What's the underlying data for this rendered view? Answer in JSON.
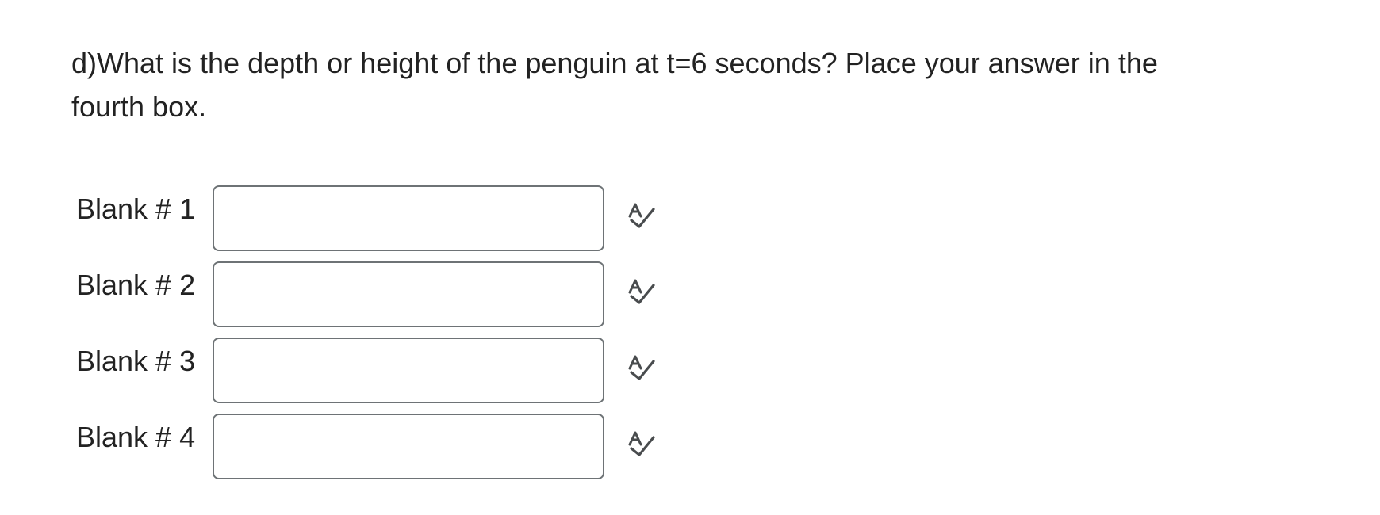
{
  "question": {
    "text": "d)What is the depth or height of the penguin at t=6 seconds? Place your answer in the fourth box."
  },
  "blanks": [
    {
      "label": "Blank # 1",
      "value": "",
      "icon": "spell-check-icon"
    },
    {
      "label": "Blank # 2",
      "value": "",
      "icon": "spell-check-icon"
    },
    {
      "label": "Blank # 3",
      "value": "",
      "icon": "spell-check-icon"
    },
    {
      "label": "Blank # 4",
      "value": "",
      "icon": "spell-check-icon"
    }
  ],
  "colors": {
    "text": "#222222",
    "input_border": "#6e7376",
    "icon": "#494c4e"
  }
}
